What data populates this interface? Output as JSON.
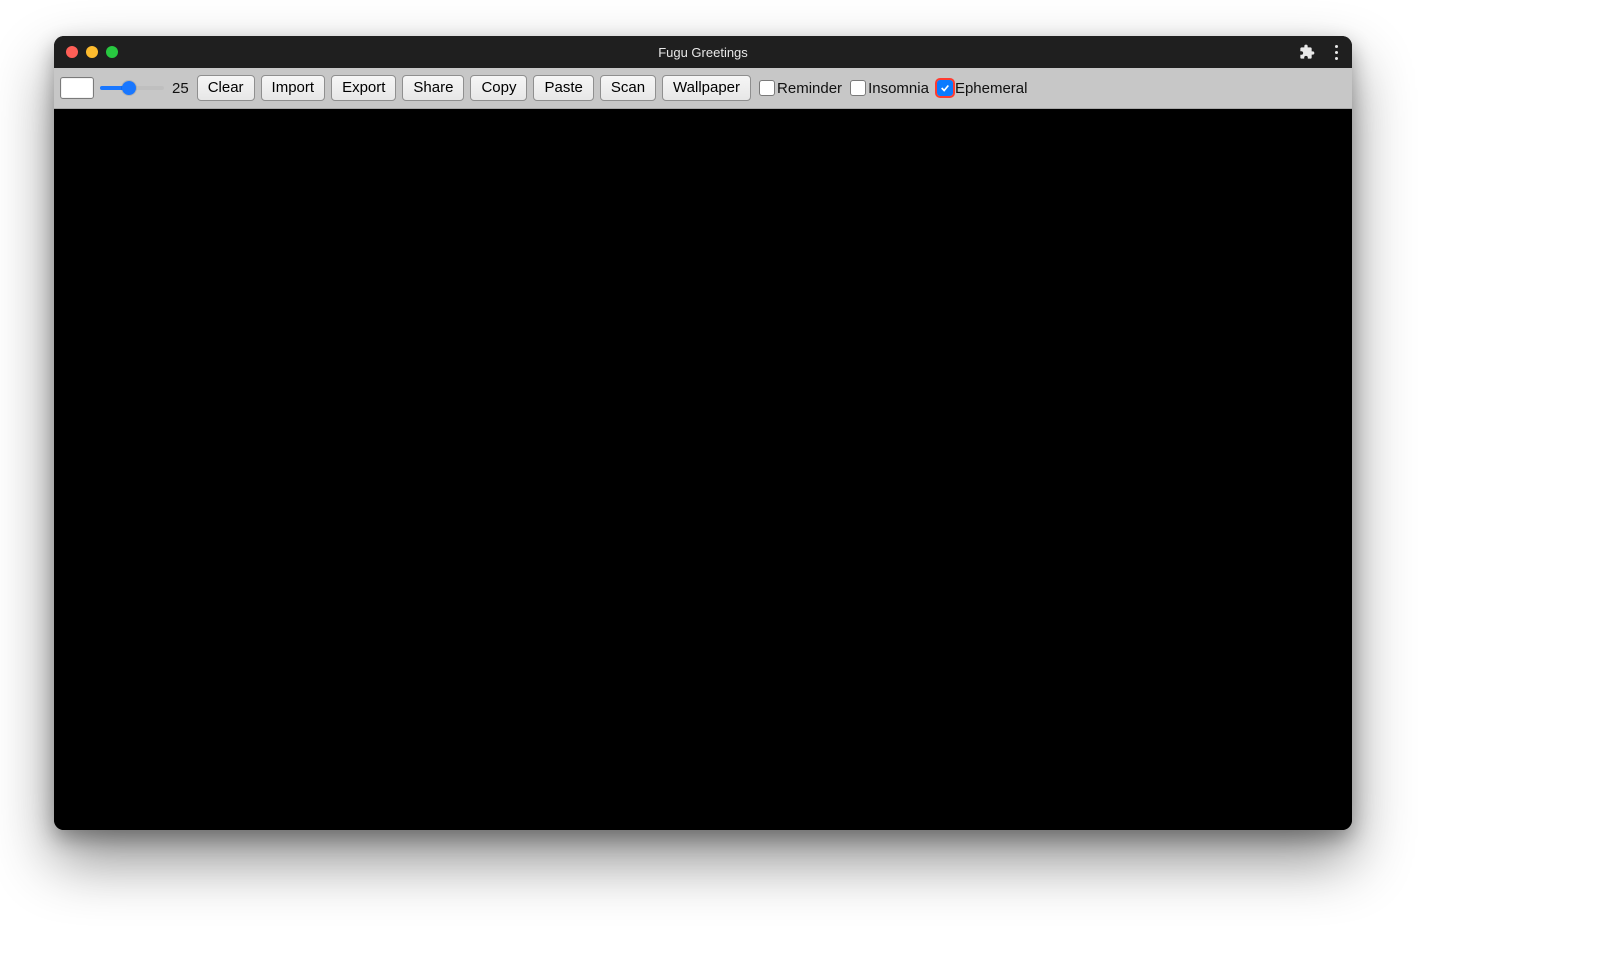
{
  "window": {
    "title": "Fugu Greetings"
  },
  "toolbar": {
    "slider_value": "25",
    "slider_percent": 45,
    "buttons": {
      "clear": "Clear",
      "import": "Import",
      "export": "Export",
      "share": "Share",
      "copy": "Copy",
      "paste": "Paste",
      "scan": "Scan",
      "wallpaper": "Wallpaper"
    },
    "checkboxes": {
      "reminder": {
        "label": "Reminder",
        "checked": false
      },
      "insomnia": {
        "label": "Insomnia",
        "checked": false
      },
      "ephemeral": {
        "label": "Ephemeral",
        "checked": true
      }
    }
  },
  "colors": {
    "accent": "#1977ff",
    "titlebar": "#1f1f1f",
    "toolbar_bg": "#c7c7c7",
    "canvas_bg": "#000000"
  }
}
